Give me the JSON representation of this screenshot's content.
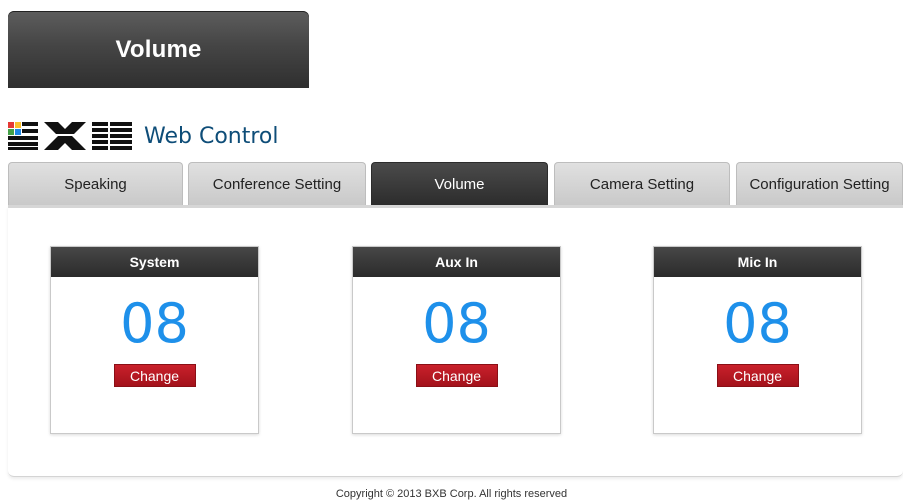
{
  "header": {
    "title": "Volume"
  },
  "brand": {
    "logo_text": "BXB",
    "title": "Web Control"
  },
  "tabs": [
    {
      "label": "Speaking",
      "active": false
    },
    {
      "label": "Conference Setting",
      "active": false
    },
    {
      "label": "Volume",
      "active": true
    },
    {
      "label": "Camera Setting",
      "active": false
    },
    {
      "label": "Configuration Setting",
      "active": false
    }
  ],
  "panels": [
    {
      "title": "System",
      "value": "08",
      "button": "Change"
    },
    {
      "title": "Aux In",
      "value": "08",
      "button": "Change"
    },
    {
      "title": "Mic In",
      "value": "08",
      "button": "Change"
    }
  ],
  "footer": {
    "copyright": "Copyright © 2013 BXB Corp. All rights reserved"
  },
  "colors": {
    "accent_value": "#1e90ea",
    "button_red": "#b5161f",
    "brand_blue": "#0e4d78",
    "active_tab": "#3a3a3a"
  }
}
